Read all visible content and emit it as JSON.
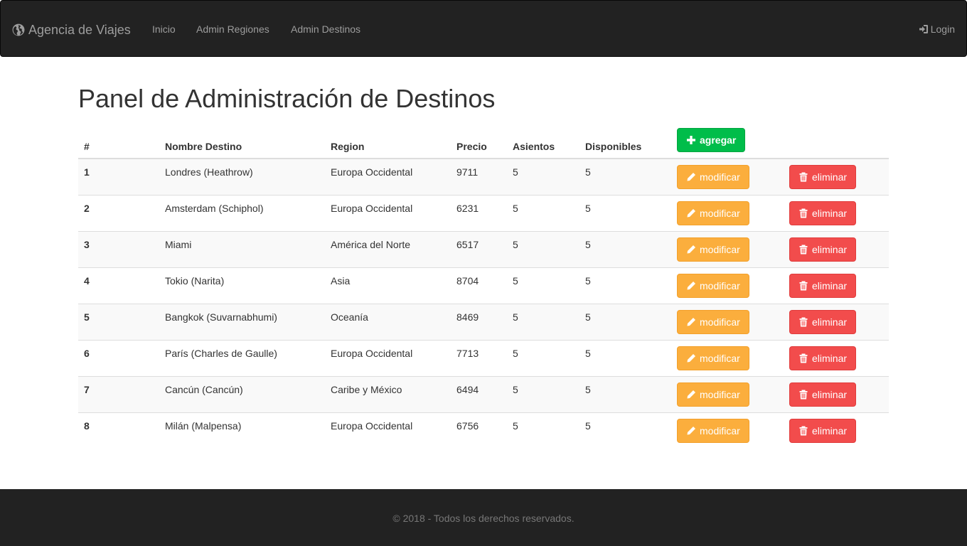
{
  "navbar": {
    "brand": "Agencia de Viajes",
    "links": [
      "Inicio",
      "Admin Regiones",
      "Admin Destinos"
    ],
    "login": "Login"
  },
  "page": {
    "title": "Panel de Administración de Destinos"
  },
  "table": {
    "headers": [
      "#",
      "Nombre Destino",
      "Region",
      "Precio",
      "Asientos",
      "Disponibles"
    ],
    "add_label": "agregar",
    "modify_label": "modificar",
    "delete_label": "eliminar",
    "rows": [
      {
        "id": "1",
        "nombre": "Londres (Heathrow)",
        "region": "Europa Occidental",
        "precio": "9711",
        "asientos": "5",
        "disponibles": "5"
      },
      {
        "id": "2",
        "nombre": "Amsterdam (Schiphol)",
        "region": "Europa Occidental",
        "precio": "6231",
        "asientos": "5",
        "disponibles": "5"
      },
      {
        "id": "3",
        "nombre": "Miami",
        "region": "América del Norte",
        "precio": "6517",
        "asientos": "5",
        "disponibles": "5"
      },
      {
        "id": "4",
        "nombre": "Tokio (Narita)",
        "region": "Asia",
        "precio": "8704",
        "asientos": "5",
        "disponibles": "5"
      },
      {
        "id": "5",
        "nombre": "Bangkok (Suvarnabhumi)",
        "region": "Oceanía",
        "precio": "8469",
        "asientos": "5",
        "disponibles": "5"
      },
      {
        "id": "6",
        "nombre": "París (Charles de Gaulle)",
        "region": "Europa Occidental",
        "precio": "7713",
        "asientos": "5",
        "disponibles": "5"
      },
      {
        "id": "7",
        "nombre": "Cancún (Cancún)",
        "region": "Caribe y México",
        "precio": "6494",
        "asientos": "5",
        "disponibles": "5"
      },
      {
        "id": "8",
        "nombre": "Milán (Malpensa)",
        "region": "Europa Occidental",
        "precio": "6756",
        "asientos": "5",
        "disponibles": "5"
      }
    ]
  },
  "footer": {
    "text": "© 2018 - Todos los derechos reservados."
  },
  "icons": {
    "brand": "globe-icon",
    "login": "log-in-icon",
    "add": "plus-icon",
    "modify": "pencil-icon",
    "delete": "trash-icon"
  },
  "colors": {
    "navbar_bg": "#222222",
    "success": "#00bd4a",
    "warning": "#fbae3d",
    "danger": "#f24c4c"
  }
}
